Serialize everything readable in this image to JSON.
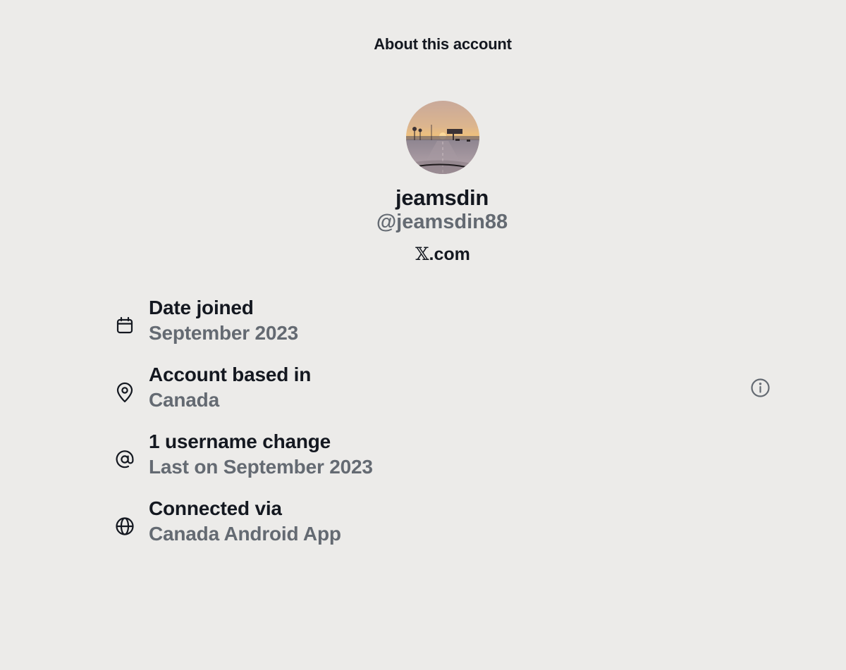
{
  "header": {
    "title": "About this account"
  },
  "profile": {
    "display_name": "jeamsdin",
    "handle": "@jeamsdin88",
    "site_glyph": "𝕏",
    "site_suffix": ".com",
    "avatar_icon": "avatar-sunset-road"
  },
  "details": [
    {
      "icon": "calendar-icon",
      "label": "Date joined",
      "value": "September 2023"
    },
    {
      "icon": "location-pin-icon",
      "label": "Account based in",
      "value": "Canada"
    },
    {
      "icon": "at-sign-icon",
      "label": "1 username change",
      "value": "Last on September 2023"
    },
    {
      "icon": "globe-icon",
      "label": "Connected via",
      "value": "Canada Android App"
    }
  ],
  "colors": {
    "background": "#ecebe9",
    "primary_text": "#141820",
    "secondary_text": "#646a72"
  }
}
